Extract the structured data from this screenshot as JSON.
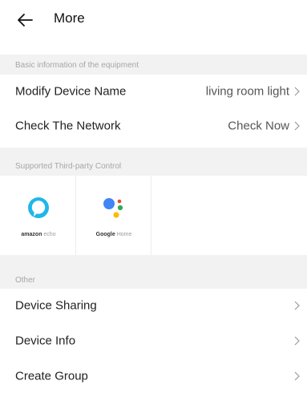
{
  "header": {
    "title": "More",
    "back_icon": "arrow-left-icon"
  },
  "sections": {
    "basic": {
      "title": "Basic information of the equipment"
    },
    "third_party": {
      "title": "Supported Third-party Control"
    },
    "other": {
      "title": "Other"
    }
  },
  "basic_rows": {
    "modify_name": {
      "label": "Modify Device Name",
      "value": "living room light"
    },
    "check_network": {
      "label": "Check The Network",
      "value": "Check Now"
    }
  },
  "third_party": {
    "amazon": {
      "name_bold": "amazon",
      "name_light": " echo",
      "icon": "alexa-icon",
      "color": "#1fb7e8"
    },
    "google": {
      "name_bold": "Google",
      "name_light": " Home",
      "icon": "google-assistant-icon",
      "colors": [
        "#4285f4",
        "#ea4335",
        "#fbbc05",
        "#34a853"
      ]
    }
  },
  "other_rows": {
    "sharing": {
      "label": "Device Sharing"
    },
    "info": {
      "label": "Device Info"
    },
    "group": {
      "label": "Create Group"
    }
  },
  "chevron_icon": "chevron-right-icon"
}
